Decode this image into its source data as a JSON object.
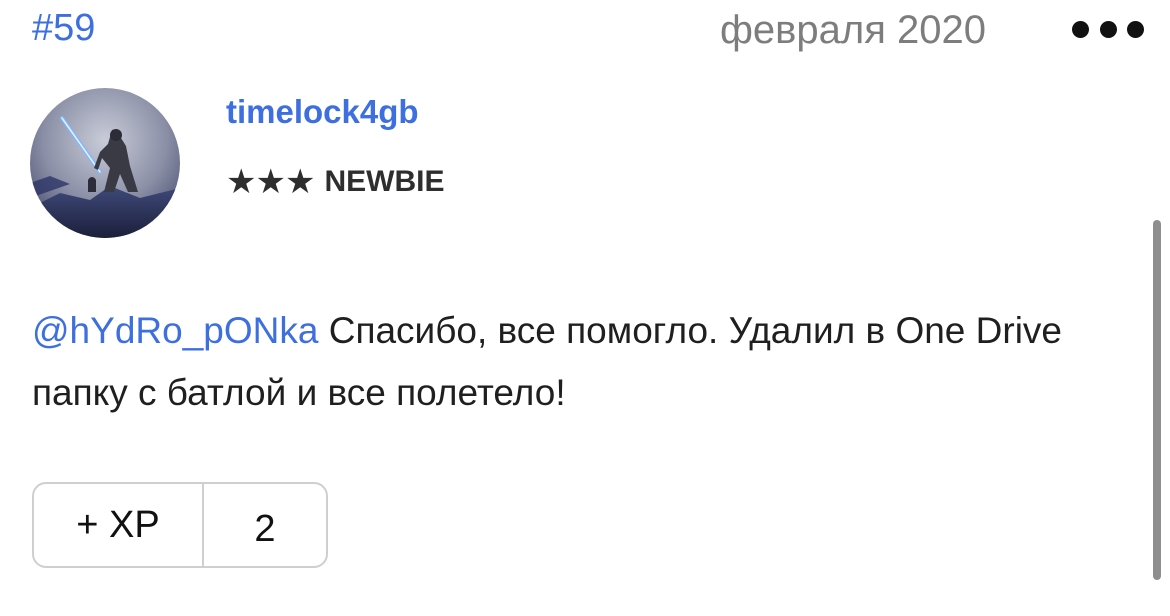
{
  "post": {
    "number": "#59",
    "date": "февраля 2020",
    "more_icon": "more-horizontal-icon"
  },
  "author": {
    "username": "timelock4gb",
    "rank_stars": "★★★",
    "rank_label": "NEWBIE",
    "avatar_icon": "avatar-image"
  },
  "message": {
    "mention": "@hYdRo_pONka",
    "text": " Спасибо, все помогло. Удалил в One Drive папку с батлой и все полетело!"
  },
  "xp": {
    "button_label": "+ XP",
    "count": "2"
  },
  "colors": {
    "link": "#3e6fe0",
    "date": "#7d7d7d",
    "border": "#cfcfcf"
  }
}
